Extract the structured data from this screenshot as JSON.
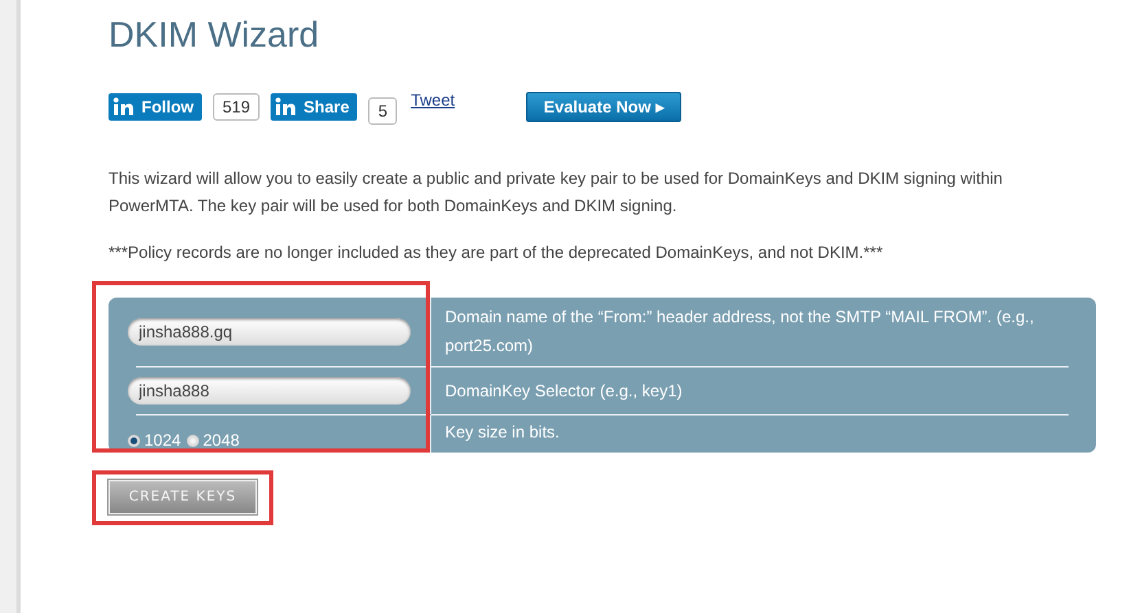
{
  "title": "DKIM Wizard",
  "social": [
    {
      "kind": "linkedin",
      "label": "Follow",
      "count": "519"
    },
    {
      "kind": "linkedin",
      "label": "Share",
      "count": "5"
    },
    {
      "kind": "link",
      "label": "Tweet"
    }
  ],
  "evaluate_button": {
    "label": "Evaluate Now",
    "arrow": "▸"
  },
  "intro": "This wizard will allow you to easily create a public and private key pair to be used for DomainKeys and DKIM signing within PowerMTA. The key pair will be used for both DomainKeys and DKIM signing.",
  "note": "***Policy records are no longer included as they are part of the deprecated DomainKeys, and not DKIM.***",
  "form": {
    "rows": [
      {
        "kind": "text",
        "value": "jinsha888.gq",
        "help": "Domain name of the “From:” header address, not the SMTP “MAIL FROM”. (e.g., port25.com)"
      },
      {
        "kind": "text",
        "value": "jinsha888",
        "help": "DomainKey Selector (e.g., key1)"
      },
      {
        "kind": "radios",
        "options": [
          {
            "label": "1024",
            "selected": true
          },
          {
            "label": "2048",
            "selected": false
          }
        ],
        "help": "Key size in bits."
      }
    ]
  },
  "create_button": {
    "label": "CREATE KEYS",
    "highlighted": true
  },
  "fields_highlighted": true
}
